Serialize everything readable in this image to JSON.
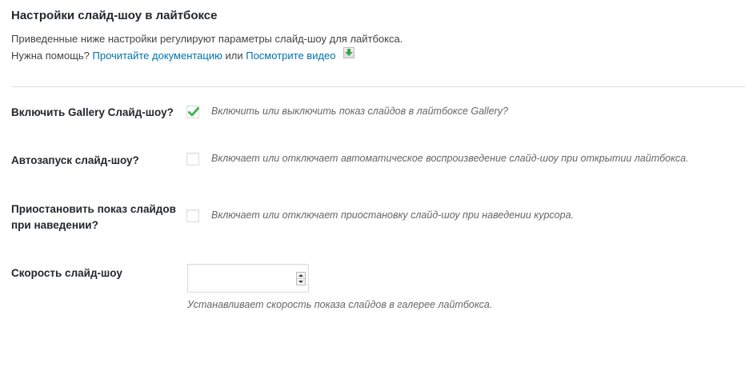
{
  "section": {
    "title": "Настройки слайд-шоу в лайтбоксе",
    "description": "Приведенные ниже настройки регулируют параметры слайд-шоу для лайтбокса.",
    "help_prefix": "Нужна помощь?",
    "doc_link": "Прочитайте документацию",
    "or_text": "или",
    "video_link": "Посмотрите видео",
    "help_icon": "download-arrow-icon"
  },
  "fields": {
    "enable_slideshow": {
      "label": "Включить Gallery Слайд-шоу?",
      "checked": true,
      "help": "Включить или выключить показ слайдов в лайтбоксе Gallery?"
    },
    "autoplay": {
      "label": "Автозапуск слайд-шоу?",
      "checked": false,
      "help": "Включает или отключает автоматическое воспроизведение слайд-шоу при открытии лайтбокса."
    },
    "pause_on_hover": {
      "label_line1": "Приостановить показ слайдов",
      "label_line2": "при наведении?",
      "checked": false,
      "help": "Включает или отключает приостановку слайд-шоу при наведении курсора."
    },
    "speed": {
      "label": "Скорость слайд-шоу",
      "value": "",
      "help": "Устанавливает скорость показа слайдов в галерее лайтбокса."
    }
  },
  "colors": {
    "link": "#0073aa",
    "checkmark": "#1e8cbe",
    "checkmark_green": "#46b450",
    "icon_green": "#3aa64a"
  }
}
